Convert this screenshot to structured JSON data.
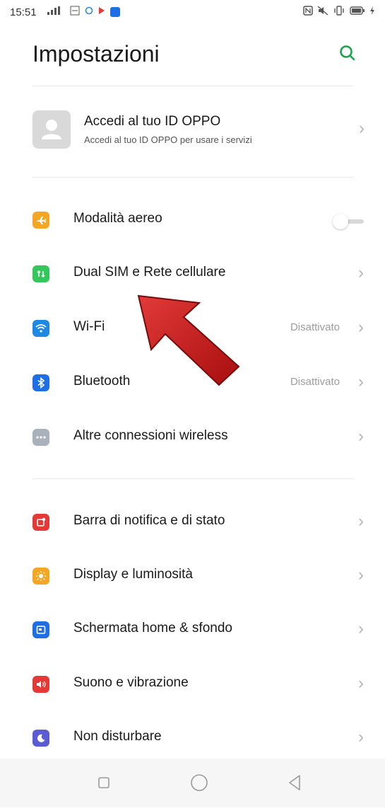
{
  "status_bar": {
    "time": "15:51",
    "left_icons": [
      "signal-icon",
      "volte-icon",
      "circle-icon",
      "play-icon",
      "app-icon"
    ],
    "right_icons": [
      "nfc-icon",
      "mute-icon",
      "vibrate-icon",
      "battery-icon",
      "charging-icon"
    ]
  },
  "header": {
    "title": "Impostazioni",
    "search_icon": "search-icon",
    "accent": "#1aa34a"
  },
  "account": {
    "title": "Accedi al tuo ID OPPO",
    "subtitle": "Accedi al tuo ID OPPO per usare i servizi"
  },
  "connectivity": [
    {
      "label": "Modalità aereo",
      "icon": "airplane-icon",
      "color": "#f5a623",
      "control": "toggle",
      "toggle_on": false
    },
    {
      "label": "Dual SIM e Rete cellulare",
      "icon": "sim-icon",
      "color": "#34c759",
      "control": "chevron"
    },
    {
      "label": "Wi-Fi",
      "icon": "wifi-icon",
      "color": "#1e88e5",
      "value": "Disattivato",
      "control": "chevron"
    },
    {
      "label": "Bluetooth",
      "icon": "bluetooth-icon",
      "color": "#1e6fe5",
      "value": "Disattivato",
      "control": "chevron"
    },
    {
      "label": "Altre connessioni wireless",
      "icon": "more-icon",
      "color": "#a9b1bd",
      "control": "chevron"
    }
  ],
  "personalization": [
    {
      "label": "Barra di notifica e di stato",
      "icon": "notification-icon",
      "color": "#e53935"
    },
    {
      "label": "Display e luminosità",
      "icon": "brightness-icon",
      "color": "#f5a623"
    },
    {
      "label": "Schermata home & sfondo",
      "icon": "wallpaper-icon",
      "color": "#1e6fe5"
    },
    {
      "label": "Suono e vibrazione",
      "icon": "sound-icon",
      "color": "#e53935"
    },
    {
      "label": "Non disturbare",
      "icon": "moon-icon",
      "color": "#5b5bd6"
    }
  ],
  "nav_bar": {
    "buttons": [
      "recent-apps-icon",
      "home-icon",
      "back-icon"
    ]
  }
}
